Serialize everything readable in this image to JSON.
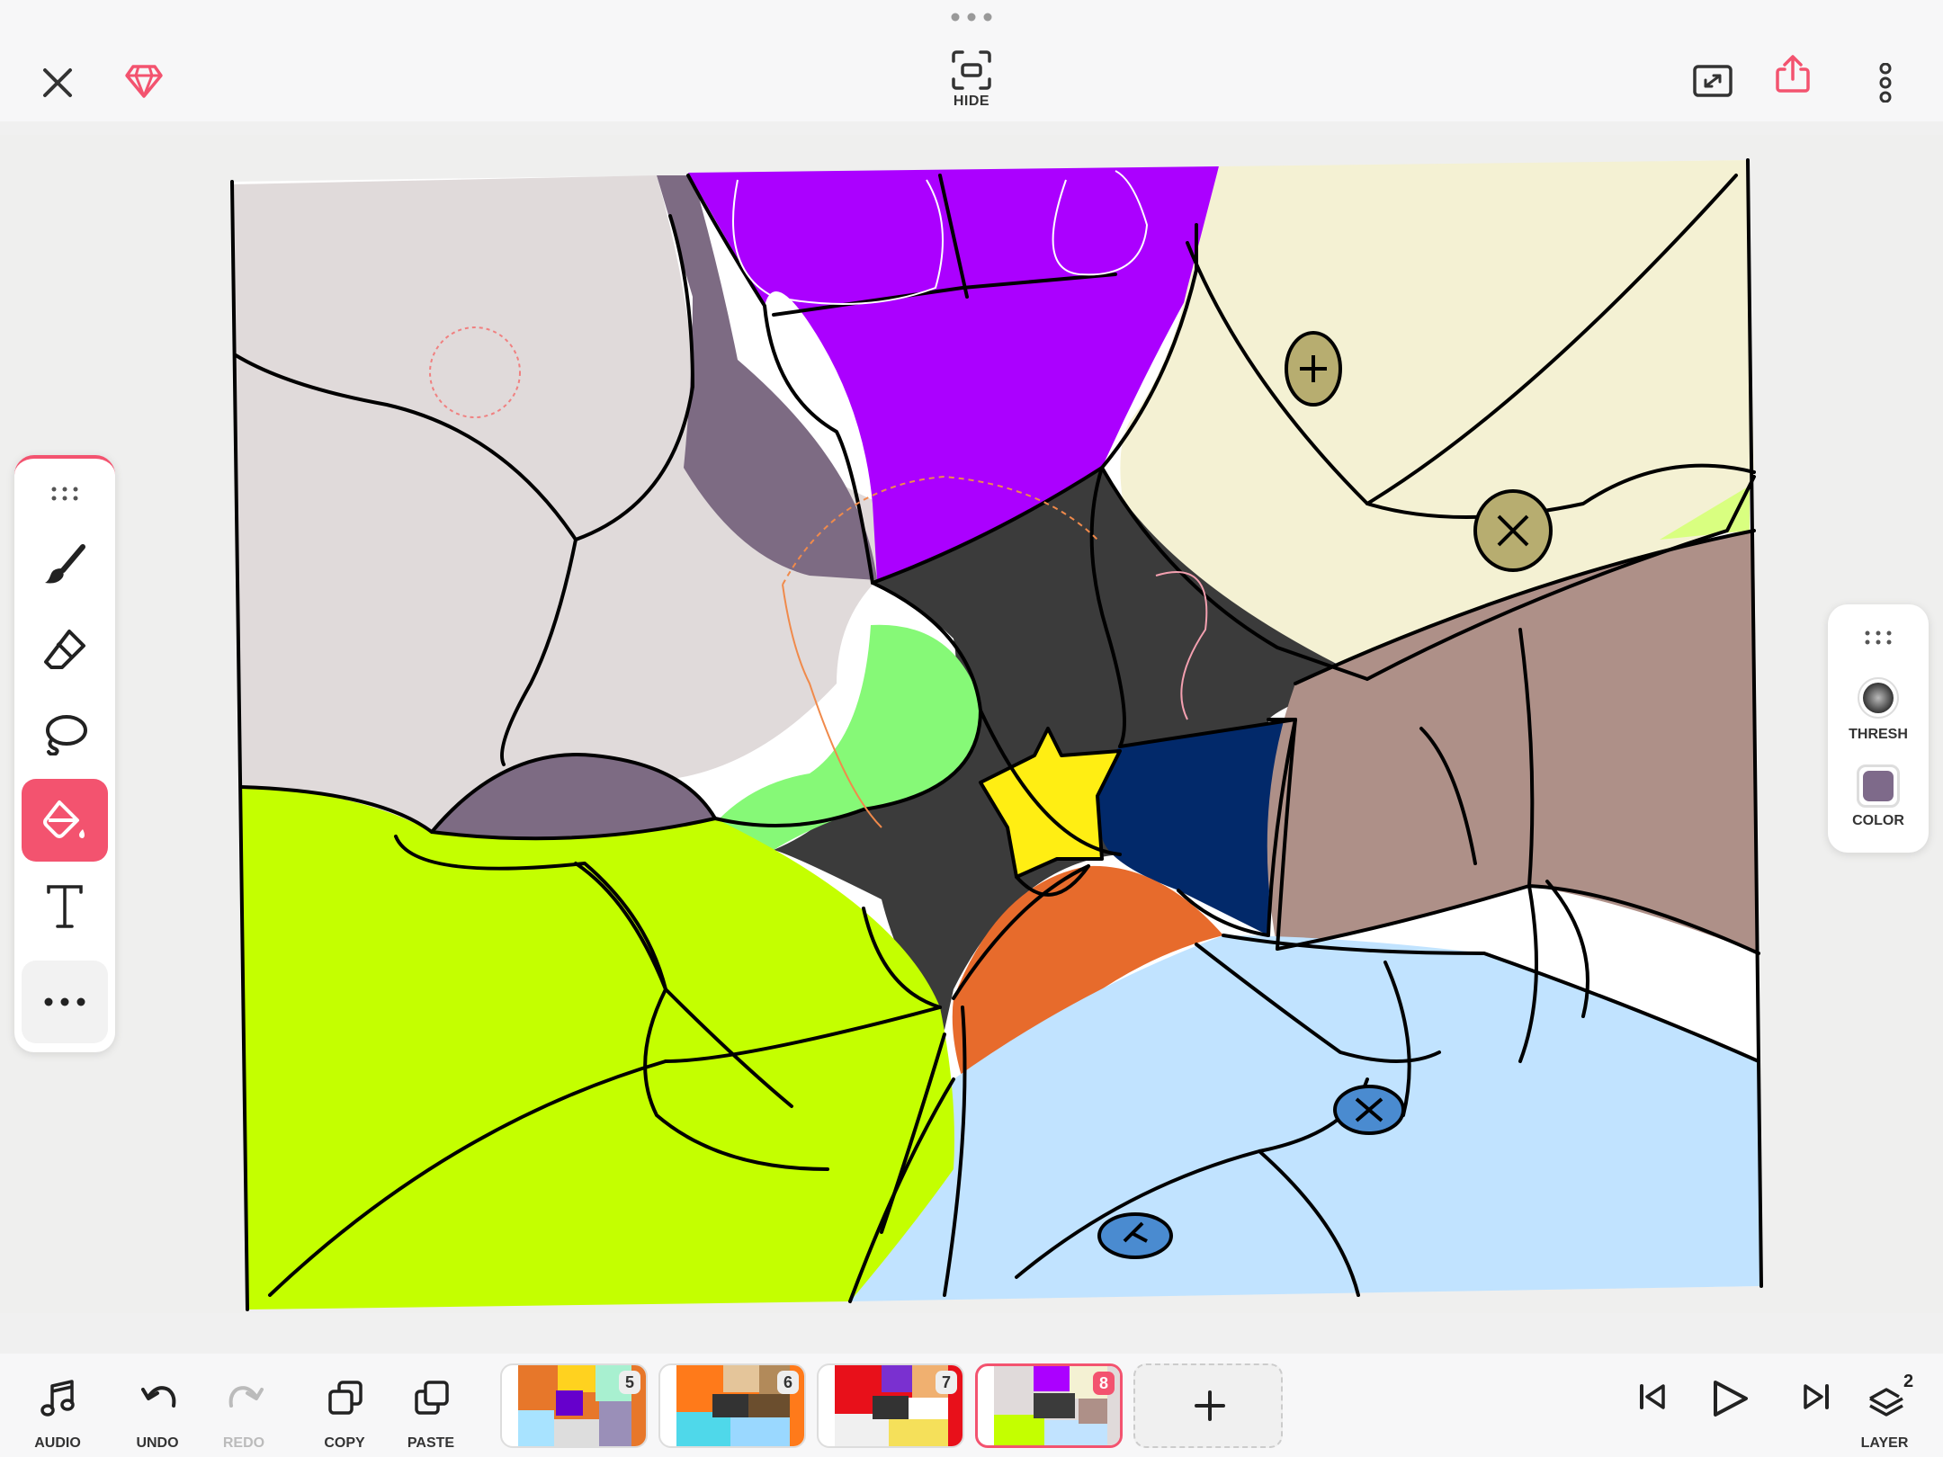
{
  "top_bar": {
    "close_icon": "close-icon",
    "premium_icon": "diamond-icon",
    "hide_label": "HIDE",
    "resize_icon": "resize-canvas-icon",
    "share_icon": "share-icon",
    "more_icon": "more-vertical-icon",
    "accent": "#f3536f"
  },
  "left_tools": {
    "items": [
      {
        "name": "brush",
        "icon": "brush-icon",
        "active": false
      },
      {
        "name": "eraser",
        "icon": "eraser-icon",
        "active": false
      },
      {
        "name": "lasso",
        "icon": "lasso-icon",
        "active": false
      },
      {
        "name": "fill",
        "icon": "paint-bucket-icon",
        "active": true
      },
      {
        "name": "text",
        "icon": "text-icon",
        "active": false
      },
      {
        "name": "more",
        "icon": "more-horizontal-icon",
        "active": false
      }
    ]
  },
  "right_panel": {
    "thresh_label": "THRESH",
    "color_label": "COLOR",
    "current_color": "#7e6a8a"
  },
  "bottom_bar": {
    "audio_label": "AUDIO",
    "undo_label": "UNDO",
    "redo_label": "REDO",
    "copy_label": "COPY",
    "paste_label": "PASTE",
    "layer_label": "LAYER",
    "layer_count": "2",
    "frames": [
      {
        "number": "5",
        "active": false
      },
      {
        "number": "6",
        "active": false
      },
      {
        "number": "7",
        "active": false
      },
      {
        "number": "8",
        "active": true
      }
    ]
  }
}
